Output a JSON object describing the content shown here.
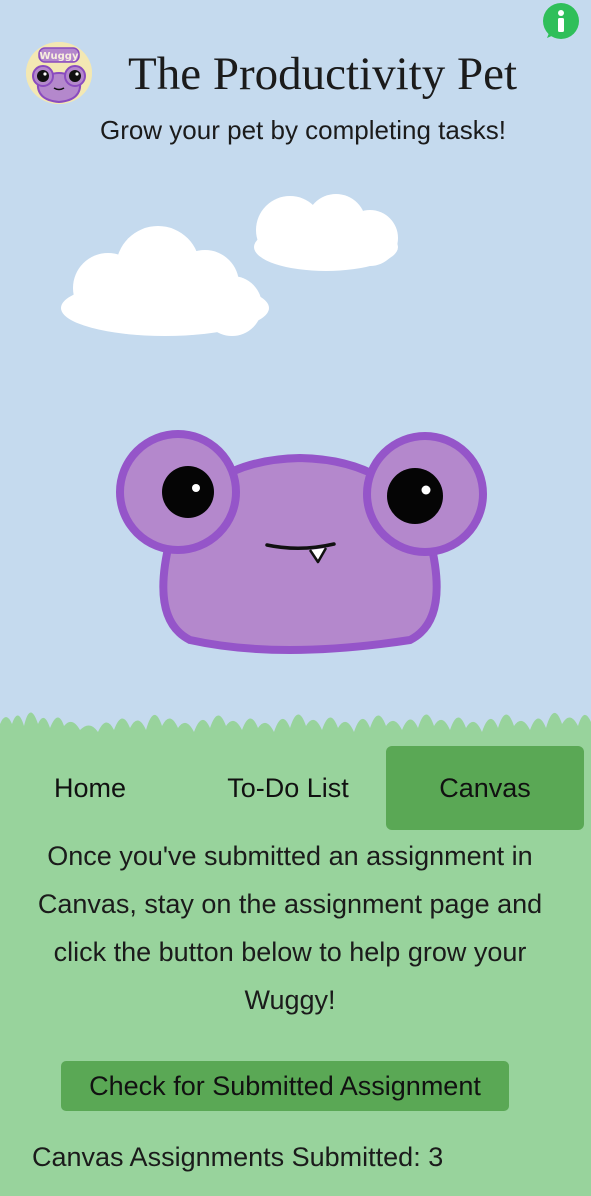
{
  "header": {
    "title": "The Productivity Pet",
    "subtitle": "Grow your pet by completing tasks!",
    "logo_text": "Wuggy"
  },
  "icons": {
    "info": "info-icon",
    "logo": "wuggy-logo-icon",
    "pet": "wuggy-pet-illustration"
  },
  "nav": {
    "tabs": [
      {
        "label": "Home",
        "active": false
      },
      {
        "label": "To-Do List",
        "active": false
      },
      {
        "label": "Canvas",
        "active": true
      }
    ]
  },
  "canvas_page": {
    "instructions": "Once you've submitted an assignment in Canvas, stay on the assignment page and click the button below to help grow your Wuggy!",
    "button_label": "Check for Submitted Assignment",
    "count_text": "Canvas Assignments Submitted: 3"
  },
  "colors": {
    "sky": "#c5daee",
    "ground": "#98d39c",
    "accent_green": "#5aa855",
    "info_green": "#2fbf5a",
    "pet_body": "#b488cc",
    "pet_outline": "#9555c9"
  }
}
